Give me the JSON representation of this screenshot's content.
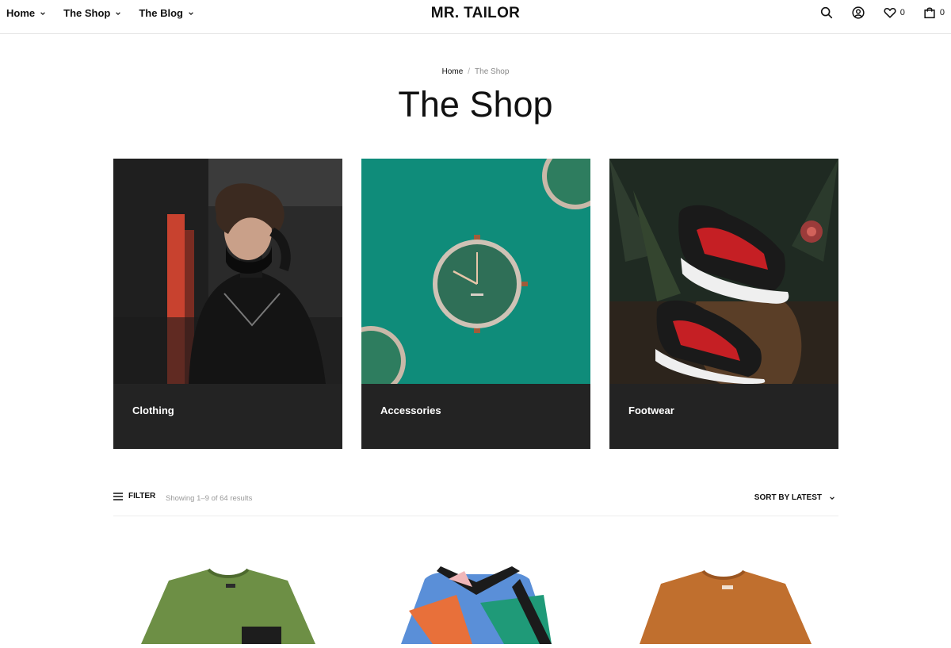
{
  "nav": {
    "items": [
      {
        "label": "Home"
      },
      {
        "label": "The Shop"
      },
      {
        "label": "The Blog"
      }
    ]
  },
  "brand": {
    "logo": "MR. TAILOR"
  },
  "header_icons": {
    "search": "search-icon",
    "account": "user-circle-icon",
    "wishlist": "heart-icon",
    "wishlist_count": "0",
    "cart": "shopping-bag-icon",
    "cart_count": "0"
  },
  "breadcrumb": {
    "home": "Home",
    "separator": "/",
    "current": "The Shop"
  },
  "page": {
    "title": "The Shop"
  },
  "categories": [
    {
      "label": "Clothing"
    },
    {
      "label": "Accessories"
    },
    {
      "label": "Footwear"
    }
  ],
  "toolbar": {
    "filter_label": "FILTER",
    "result_count": "Showing 1–9 of 64 results",
    "sort_label": "SORT BY LATEST"
  },
  "colors": {
    "card_background": "#232323",
    "text": "#111111",
    "muted": "#999999",
    "border": "#e4e4e4"
  }
}
